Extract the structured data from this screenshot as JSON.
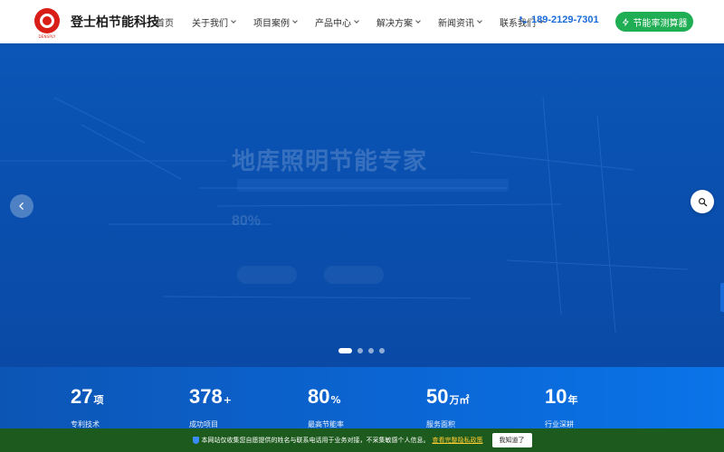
{
  "header": {
    "brand": "登士柏节能科技",
    "logo_sub": "DENSPLY",
    "nav": [
      {
        "label": "首页",
        "dropdown": false
      },
      {
        "label": "关于我们",
        "dropdown": true
      },
      {
        "label": "项目案例",
        "dropdown": true
      },
      {
        "label": "产品中心",
        "dropdown": true
      },
      {
        "label": "解决方案",
        "dropdown": true
      },
      {
        "label": "新闻资讯",
        "dropdown": true
      },
      {
        "label": "联系我们",
        "dropdown": true
      }
    ],
    "phone": "189-2129-7301",
    "calc_button": "节能率测算器"
  },
  "hero": {
    "title": "地库照明节能专家",
    "stat": "80%",
    "dots": 4,
    "active_dot": 0
  },
  "stats": [
    {
      "value": "27",
      "unit": "项",
      "label": "专利技术"
    },
    {
      "value": "378",
      "unit": "+",
      "label": "成功项目"
    },
    {
      "value": "80",
      "unit": "%",
      "label": "最高节能率"
    },
    {
      "value": "50",
      "unit": "万㎡",
      "label": "服务面积"
    },
    {
      "value": "10",
      "unit": "年",
      "label": "行业深耕"
    }
  ],
  "cookie": {
    "message": "本网站仅收集您自愿提供的姓名与联系电话用于业务对接，不采集敏感个人信息。",
    "link": "查看完整隐私政策",
    "button": "我知道了"
  },
  "colors": {
    "brand_red": "#d91e18",
    "primary_blue": "#1a6bd8",
    "cta_green": "#1fae53",
    "cookie_bg": "#1d5a1d"
  }
}
